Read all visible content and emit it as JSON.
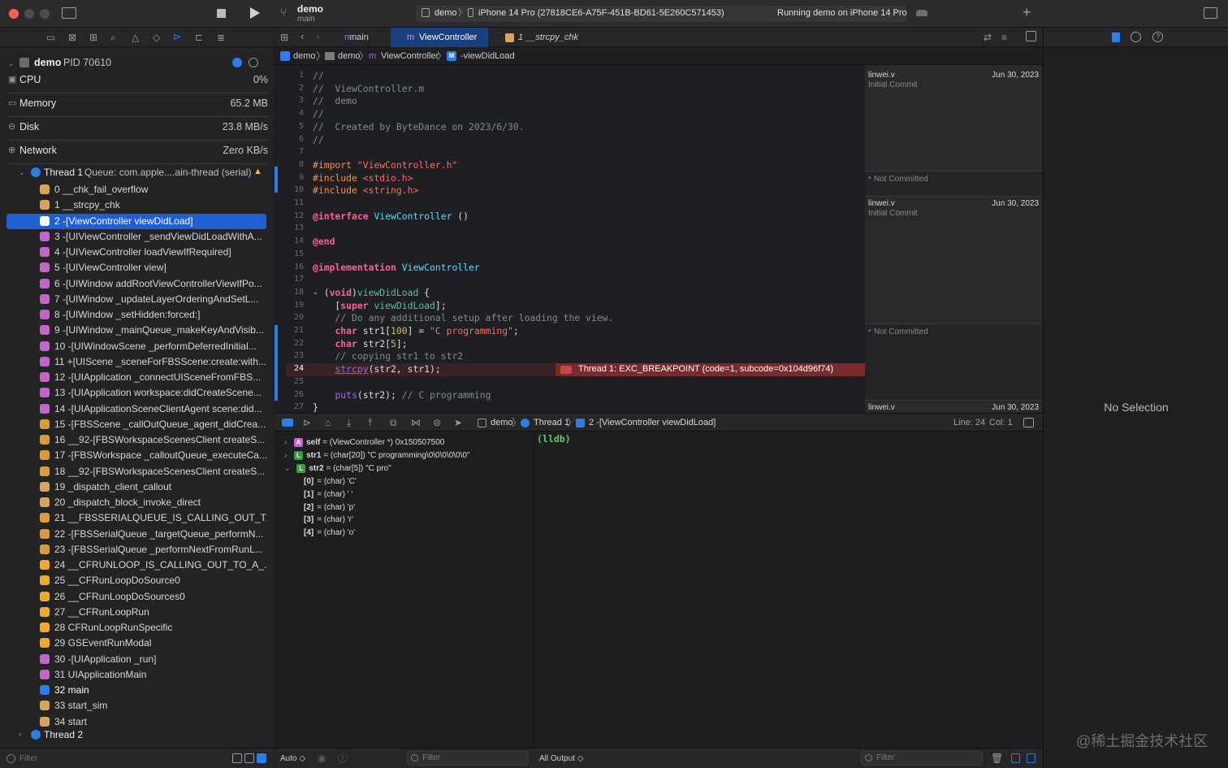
{
  "toolbar": {
    "project": "demo",
    "branch": "main",
    "scheme": "demo",
    "device": "iPhone 14 Pro (27818CE6-A75F-451B-BD61-5E260C571453)",
    "status": "Running demo on iPhone 14 Pro",
    "add_symbol": "+"
  },
  "process": {
    "name": "demo",
    "pid": "PID 70610"
  },
  "gauges": [
    {
      "label": "CPU",
      "value": "0%"
    },
    {
      "label": "Memory",
      "value": "65.2 MB"
    },
    {
      "label": "Disk",
      "value": "23.8 MB/s"
    },
    {
      "label": "Network",
      "value": "Zero KB/s"
    }
  ],
  "thread1": {
    "label": "Thread 1",
    "queue": "Queue: com.apple....ain-thread (serial)"
  },
  "frames": [
    {
      "text": "0 __chk_fail_overflow",
      "kind": "lib"
    },
    {
      "text": "1 __strcpy_chk",
      "kind": "lib"
    },
    {
      "text": "2 -[ViewController viewDidLoad]",
      "kind": "user"
    },
    {
      "text": "3 -[UIViewController _sendViewDidLoadWithA...",
      "kind": "uikit"
    },
    {
      "text": "4 -[UIViewController loadViewIfRequired]",
      "kind": "uikit"
    },
    {
      "text": "5 -[UIViewController view]",
      "kind": "uikit"
    },
    {
      "text": "6 -[UIWindow addRootViewControllerViewIfPo...",
      "kind": "uikit"
    },
    {
      "text": "7 -[UIWindow _updateLayerOrderingAndSetL...",
      "kind": "uikit"
    },
    {
      "text": "8 -[UIWindow _setHidden:forced:]",
      "kind": "uikit"
    },
    {
      "text": "9 -[UIWindow _mainQueue_makeKeyAndVisib...",
      "kind": "uikit"
    },
    {
      "text": "10 -[UIWindowScene _performDeferredInitial...",
      "kind": "uikit"
    },
    {
      "text": "11 +[UIScene _sceneForFBSScene:create:with...",
      "kind": "uikit"
    },
    {
      "text": "12 -[UIApplication _connectUISceneFromFBS...",
      "kind": "uikit"
    },
    {
      "text": "13 -[UIApplication workspace:didCreateScene...",
      "kind": "uikit"
    },
    {
      "text": "14 -[UIApplicationSceneClientAgent scene:did...",
      "kind": "uikit"
    },
    {
      "text": "15 -[FBSScene _callOutQueue_agent_didCrea...",
      "kind": "fw"
    },
    {
      "text": "16 __92-[FBSWorkspaceScenesClient createS...",
      "kind": "fw"
    },
    {
      "text": "17 -[FBSWorkspace _calloutQueue_executeCa...",
      "kind": "fw"
    },
    {
      "text": "18 __92-[FBSWorkspaceScenesClient createS...",
      "kind": "fw"
    },
    {
      "text": "19 _dispatch_client_callout",
      "kind": "lib"
    },
    {
      "text": "20 _dispatch_block_invoke_direct",
      "kind": "lib"
    },
    {
      "text": "21 __FBSSERIALQUEUE_IS_CALLING_OUT_T...",
      "kind": "fw"
    },
    {
      "text": "22 -[FBSSerialQueue _targetQueue_performN...",
      "kind": "fw"
    },
    {
      "text": "23 -[FBSSerialQueue _performNextFromRunL...",
      "kind": "fw"
    },
    {
      "text": "24 __CFRUNLOOP_IS_CALLING_OUT_TO_A_...",
      "kind": "cf"
    },
    {
      "text": "25 __CFRunLoopDoSource0",
      "kind": "cf"
    },
    {
      "text": "26 __CFRunLoopDoSources0",
      "kind": "cf"
    },
    {
      "text": "27 __CFRunLoopRun",
      "kind": "cf"
    },
    {
      "text": "28 CFRunLoopRunSpecific",
      "kind": "cf"
    },
    {
      "text": "29 GSEventRunModal",
      "kind": "cf"
    },
    {
      "text": "30 -[UIApplication _run]",
      "kind": "uikit"
    },
    {
      "text": "31 UIApplicationMain",
      "kind": "uikit"
    },
    {
      "text": "32 main",
      "kind": "user"
    },
    {
      "text": "33 start_sim",
      "kind": "lib"
    },
    {
      "text": "34 start",
      "kind": "lib"
    }
  ],
  "thread2": {
    "label": "Thread 2"
  },
  "sidebar_filter": {
    "placeholder": "Filter"
  },
  "tabs": {
    "main": "main",
    "viewcontroller": "ViewController",
    "strcpy": "1 __strcpy_chk"
  },
  "jumpbar": {
    "project": "demo",
    "folder": "demo",
    "file": "ViewController",
    "method": "-viewDidLoad"
  },
  "code_lines": [
    "//",
    "//  ViewController.m",
    "//  demo",
    "//",
    "//  Created by ByteDance on 2023/6/30.",
    "//",
    "",
    "#import \"ViewController.h\"",
    "#include <stdio.h>",
    "#include <string.h>",
    "",
    "@interface ViewController ()",
    "",
    "@end",
    "",
    "@implementation ViewController",
    "",
    "- (void)viewDidLoad {",
    "    [super viewDidLoad];",
    "    // Do any additional setup after loading the view.",
    "    char str1[100] = \"C programming\";",
    "    char str2[5];",
    "    // copying str1 to str2",
    "    strcpy(str2, str1);",
    "",
    "    puts(str2); // C programming",
    "}"
  ],
  "error_banner": "Thread 1: EXC_BREAKPOINT (code=1, subcode=0x104d96f74)",
  "blame": [
    {
      "author": "linwei.v",
      "message": "Initial Commit",
      "date": "Jun 30, 2023"
    },
    {
      "author": "",
      "message": "Not Committed",
      "date": ""
    },
    {
      "author": "linwei.v",
      "message": "Initial Commit",
      "date": "Jun 30, 2023"
    },
    {
      "author": "",
      "message": "Not Committed",
      "date": ""
    },
    {
      "author": "linwei.v",
      "message": "",
      "date": "Jun 30, 2023"
    }
  ],
  "debug_bar": {
    "project": "demo",
    "thread": "Thread 1",
    "frame": "2 -[ViewController viewDidLoad]",
    "line": "Line: 24",
    "col": "Col: 1"
  },
  "variables": {
    "self": {
      "name": "self",
      "value": "= (ViewController *) 0x150507500"
    },
    "str1": {
      "name": "str1",
      "value": "= (char[20]) \"C programming\\0\\0\\0\\0\\0\\0\""
    },
    "str2": {
      "name": "str2",
      "value": "= (char[5]) \"C pro\""
    },
    "elements": [
      {
        "name": "[0]",
        "value": "= (char) 'C'"
      },
      {
        "name": "[1]",
        "value": "= (char) ' '"
      },
      {
        "name": "[2]",
        "value": "= (char) 'p'"
      },
      {
        "name": "[3]",
        "value": "= (char) 'r'"
      },
      {
        "name": "[4]",
        "value": "= (char) 'o'"
      }
    ]
  },
  "console": {
    "prompt": "(lldb)"
  },
  "bottom": {
    "auto": "Auto ◇",
    "filter": "Filter",
    "all_output": "All Output ◇",
    "filter2": "Filter"
  },
  "inspector": {
    "empty": "No Selection"
  },
  "watermark": "@稀土掘金技术社区",
  "colors": {
    "accent": "#1f5fd1",
    "error": "#7a2a2a",
    "lib": "#d7a55a",
    "uikit": "#c466c9",
    "fw": "#d99c3c",
    "cf": "#f0a830",
    "user": "#2b7de9"
  }
}
